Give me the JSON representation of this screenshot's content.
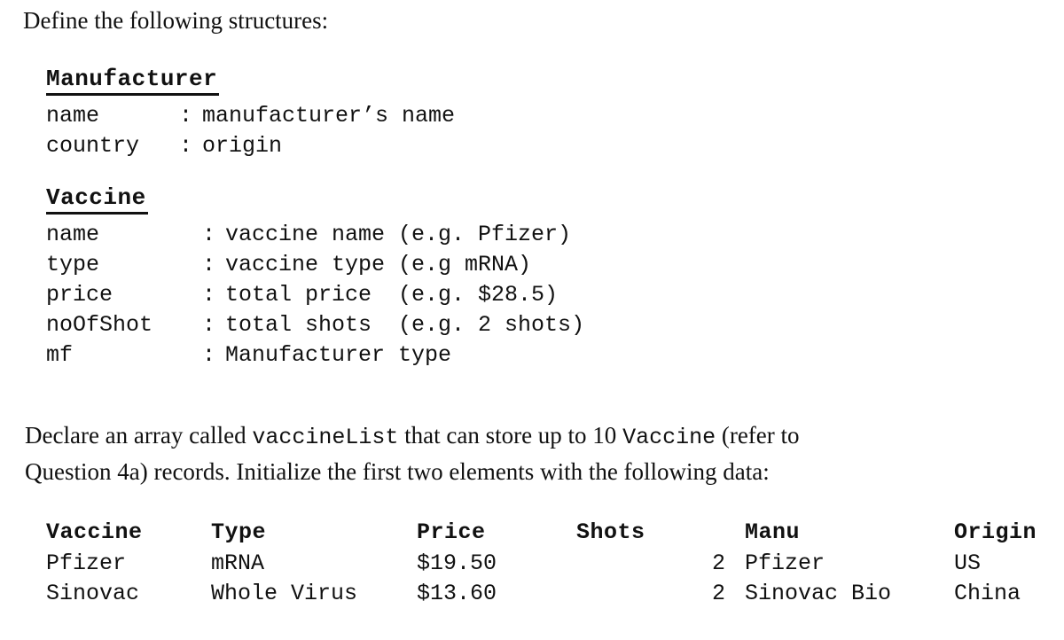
{
  "document": {
    "intro_line": "Define the following structures:",
    "structs": [
      {
        "title": "Manufacturer",
        "fields": [
          {
            "name": "name",
            "colon": ":",
            "desc": "manufacturer’s name"
          },
          {
            "name": "country",
            "colon": ":",
            "desc": "origin"
          }
        ]
      },
      {
        "title": "Vaccine",
        "fields": [
          {
            "name": "name",
            "colon": ":",
            "desc": "vaccine name (e.g. Pfizer)"
          },
          {
            "name": "type",
            "colon": ":",
            "desc": "vaccine type (e.g mRNA)"
          },
          {
            "name": "price",
            "colon": ":",
            "desc": "total price  (e.g. $28.5)"
          },
          {
            "name": "noOfShot",
            "colon": ":",
            "desc": "total shots  (e.g. 2 shots)"
          },
          {
            "name": "mf",
            "colon": ":",
            "desc": "Manufacturer type"
          }
        ]
      }
    ],
    "declare": {
      "line1_part1": "Declare an array called ",
      "line1_code1": "vaccineList",
      "line1_part2": " that can store up to 10 ",
      "line1_code2": "Vaccine",
      "line1_part3": " (refer to",
      "line2": "Question 4a) records. Initialize the first two elements with the following data:"
    },
    "table": {
      "headers": [
        "Vaccine",
        "Type",
        "Price",
        "Shots",
        "Manu",
        "Origin"
      ],
      "rows": [
        [
          "Pfizer",
          "mRNA",
          "$19.50",
          "2",
          "Pfizer",
          "US"
        ],
        [
          "Sinovac",
          "Whole Virus",
          "$13.60",
          "2",
          "Sinovac Bio",
          "China"
        ]
      ]
    }
  },
  "colors": {
    "background": "#ffffff",
    "text": "#111111",
    "rule": "#111111"
  }
}
